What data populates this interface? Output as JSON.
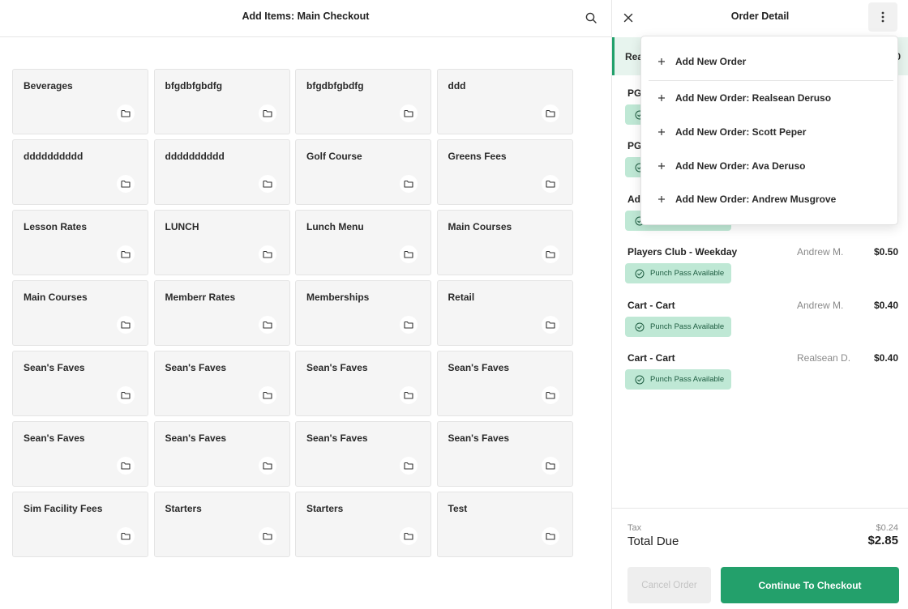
{
  "left": {
    "title": "Add Items: Main Checkout",
    "tiles": [
      "Beverages",
      "bfgdbfgbdfg",
      "bfgdbfgbdfg",
      "ddd",
      "dddddddddd",
      "dddddddddd",
      "Golf Course",
      "Greens Fees",
      "Lesson Rates",
      "LUNCH",
      "Lunch Menu",
      "Main Courses",
      "Main Courses",
      "Memberr Rates",
      "Memberships",
      "Retail",
      "Sean's Faves",
      "Sean's Faves",
      "Sean's Faves",
      "Sean's Faves",
      "Sean's Faves",
      "Sean's Faves",
      "Sean's Faves",
      "Sean's Faves",
      "Sim Facility Fees",
      "Starters",
      "Starters",
      "Test"
    ]
  },
  "right": {
    "title": "Order Detail",
    "customer": {
      "name": "Rea",
      "amount": "0"
    },
    "items": [
      {
        "name": "PG",
        "owner": "",
        "price": "",
        "badge": ""
      },
      {
        "name": "PG",
        "owner": "",
        "price": "",
        "badge": ""
      },
      {
        "name": "Ad",
        "owner": "",
        "price": "",
        "badge": "Punch Pass Available"
      },
      {
        "name": "Players Club - Weekday",
        "owner": "Andrew M.",
        "price": "$0.50",
        "badge": "Punch Pass Available"
      },
      {
        "name": "Cart - Cart",
        "owner": "Andrew M.",
        "price": "$0.40",
        "badge": "Punch Pass Available"
      },
      {
        "name": "Cart - Cart",
        "owner": "Realsean D.",
        "price": "$0.40",
        "badge": "Punch Pass Available"
      }
    ],
    "tax_label": "Tax",
    "tax_value": "$0.24",
    "total_label": "Total Due",
    "total_value": "$2.85",
    "cancel_label": "Cancel Order",
    "checkout_label": "Continue To Checkout"
  },
  "menu": {
    "items": [
      "Add New Order",
      "Add New Order: Realsean Deruso",
      "Add New Order: Scott Peper",
      "Add New Order: Ava Deruso",
      "Add New Order: Andrew Musgrove"
    ]
  },
  "icons": {
    "search": "search-icon",
    "close": "close-icon",
    "more": "more-vertical-icon",
    "folder": "folder-icon",
    "check_circle": "check-circle-icon",
    "plus": "plus-icon"
  },
  "colors": {
    "accent": "#23a06b",
    "badge_bg": "#bfe8d5",
    "tile_bg": "#f5f5f5"
  }
}
